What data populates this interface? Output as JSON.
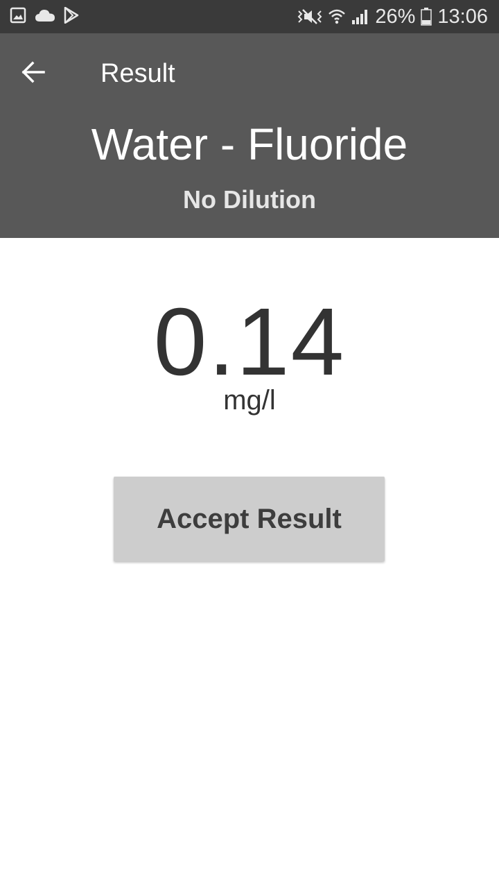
{
  "status_bar": {
    "battery_percent": "26%",
    "time": "13:06",
    "left_icons": [
      "gallery-icon",
      "cloud-icon",
      "play-store-icon"
    ],
    "right_icons": [
      "mute-icon",
      "wifi-icon",
      "signal-icon",
      "battery-icon"
    ]
  },
  "toolbar": {
    "title": "Result",
    "back_icon": "arrow-left-icon"
  },
  "header": {
    "test_name": "Water - Fluoride",
    "dilution": "No Dilution"
  },
  "result": {
    "value": "0.14",
    "unit": "mg/l"
  },
  "actions": {
    "accept_label": "Accept Result"
  },
  "colors": {
    "status_bar": "#3a3a3a",
    "app_bar": "#585858",
    "button": "#cdcdcd",
    "text_dark": "#333333"
  }
}
